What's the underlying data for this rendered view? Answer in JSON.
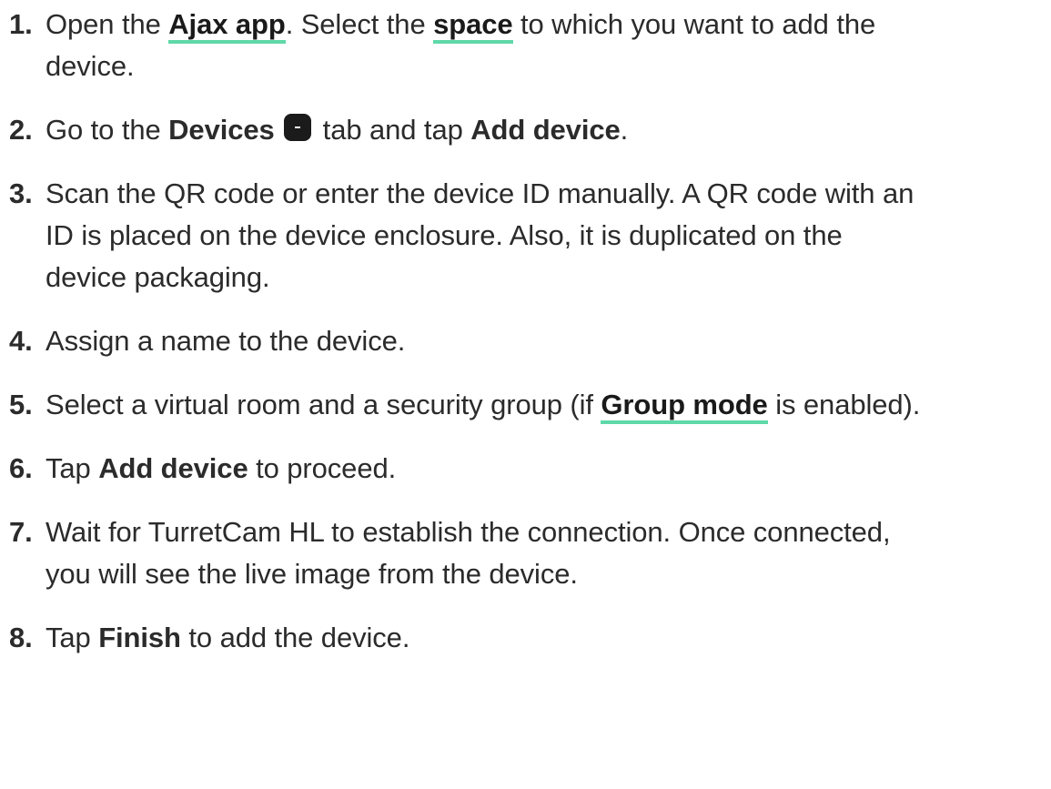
{
  "steps": [
    {
      "num": "1.",
      "parts": [
        {
          "t": "text",
          "v": "Open the "
        },
        {
          "t": "link",
          "v": "Ajax app",
          "name": "ajax-app-link"
        },
        {
          "t": "text",
          "v": ". Select the "
        },
        {
          "t": "link",
          "v": "space",
          "name": "space-link"
        },
        {
          "t": "text",
          "v": " to which you want to add the"
        },
        {
          "t": "br"
        },
        {
          "t": "text",
          "v": "device."
        }
      ]
    },
    {
      "num": "2.",
      "parts": [
        {
          "t": "text",
          "v": "Go to the "
        },
        {
          "t": "bold",
          "v": "Devices"
        },
        {
          "t": "text",
          "v": " "
        },
        {
          "t": "icon",
          "name": "devices-tab-icon"
        },
        {
          "t": "text",
          "v": " tab and tap "
        },
        {
          "t": "bold",
          "v": "Add device"
        },
        {
          "t": "text",
          "v": "."
        }
      ]
    },
    {
      "num": "3.",
      "parts": [
        {
          "t": "text",
          "v": "Scan the QR code or enter the device ID manually. A QR code with an"
        },
        {
          "t": "br"
        },
        {
          "t": "text",
          "v": "ID is placed on the device enclosure. Also, it is duplicated on the"
        },
        {
          "t": "br"
        },
        {
          "t": "text",
          "v": "device packaging."
        }
      ]
    },
    {
      "num": "4.",
      "parts": [
        {
          "t": "text",
          "v": "Assign a name to the device."
        }
      ]
    },
    {
      "num": "5.",
      "parts": [
        {
          "t": "text",
          "v": "Select a virtual room and a security group (if "
        },
        {
          "t": "link",
          "v": "Group mode",
          "name": "group-mode-link"
        },
        {
          "t": "text",
          "v": " is enabled)."
        }
      ]
    },
    {
      "num": "6.",
      "parts": [
        {
          "t": "text",
          "v": "Tap "
        },
        {
          "t": "bold",
          "v": "Add device"
        },
        {
          "t": "text",
          "v": " to proceed."
        }
      ]
    },
    {
      "num": "7.",
      "parts": [
        {
          "t": "text",
          "v": "Wait for TurretCam HL to establish the connection. Once connected,"
        },
        {
          "t": "br"
        },
        {
          "t": "text",
          "v": "you will see the live image from the device."
        }
      ]
    },
    {
      "num": "8.",
      "parts": [
        {
          "t": "text",
          "v": "Tap "
        },
        {
          "t": "bold",
          "v": "Finish"
        },
        {
          "t": "text",
          "v": " to add the device."
        }
      ]
    }
  ],
  "colors": {
    "link_underline": "#5fd8a8",
    "text": "#2b2b2b",
    "icon_bg": "#1b1b1b"
  }
}
